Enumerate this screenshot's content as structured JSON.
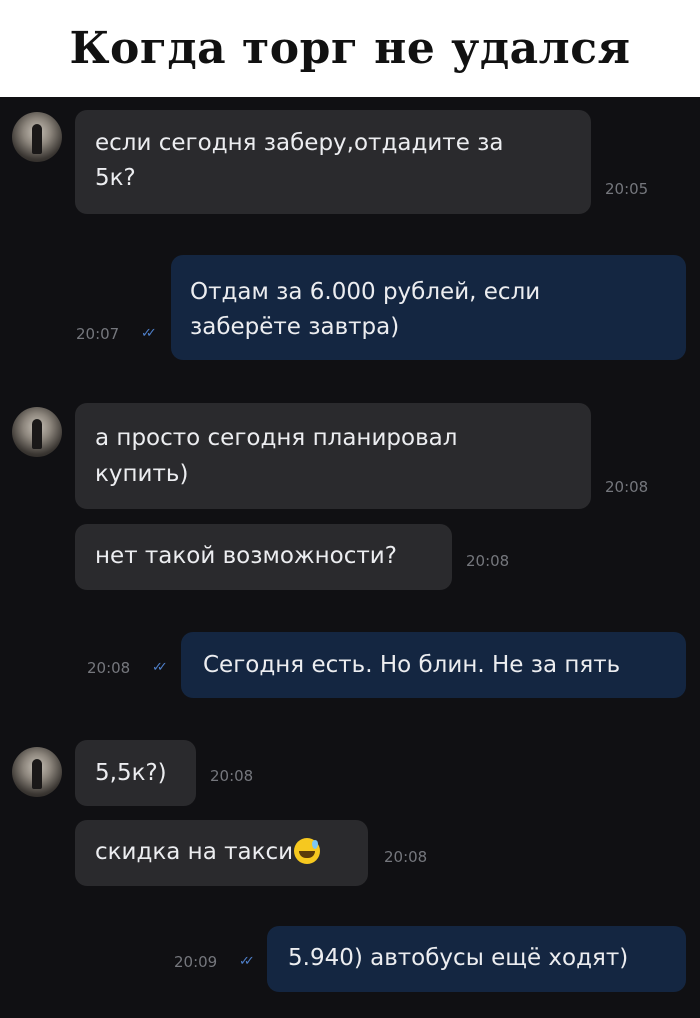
{
  "header": {
    "title": "Когда торг не удался"
  },
  "messages": [
    {
      "dir": "in",
      "text1": "если сегодня заберу,отдадите за",
      "text2": "5к?",
      "time": "20:05"
    },
    {
      "dir": "out",
      "text1": "Отдам за 6.000 рублей, если",
      "text2": "заберёте завтра)",
      "time": "20:07"
    },
    {
      "dir": "in",
      "text1": "а просто сегодня планировал",
      "text2": "купить)",
      "time": "20:08"
    },
    {
      "dir": "in",
      "text": "нет такой возможности?",
      "time": "20:08"
    },
    {
      "dir": "out",
      "text": "Сегодня есть. Но блин. Не за пять",
      "time": "20:08"
    },
    {
      "dir": "in",
      "text": "5,5к?)",
      "time": "20:08"
    },
    {
      "dir": "in",
      "text": "скидка на такси",
      "emoji": "grinning-sweat-emoji",
      "time": "20:08"
    },
    {
      "dir": "out",
      "text": "5.940) автобусы ещё ходят)",
      "time": "20:09"
    }
  ],
  "read_ticks": "✓✓",
  "colors": {
    "incoming": "#2a2a2d",
    "outgoing": "#142641",
    "background": "#101013",
    "ticks": "#4e7fc9"
  }
}
